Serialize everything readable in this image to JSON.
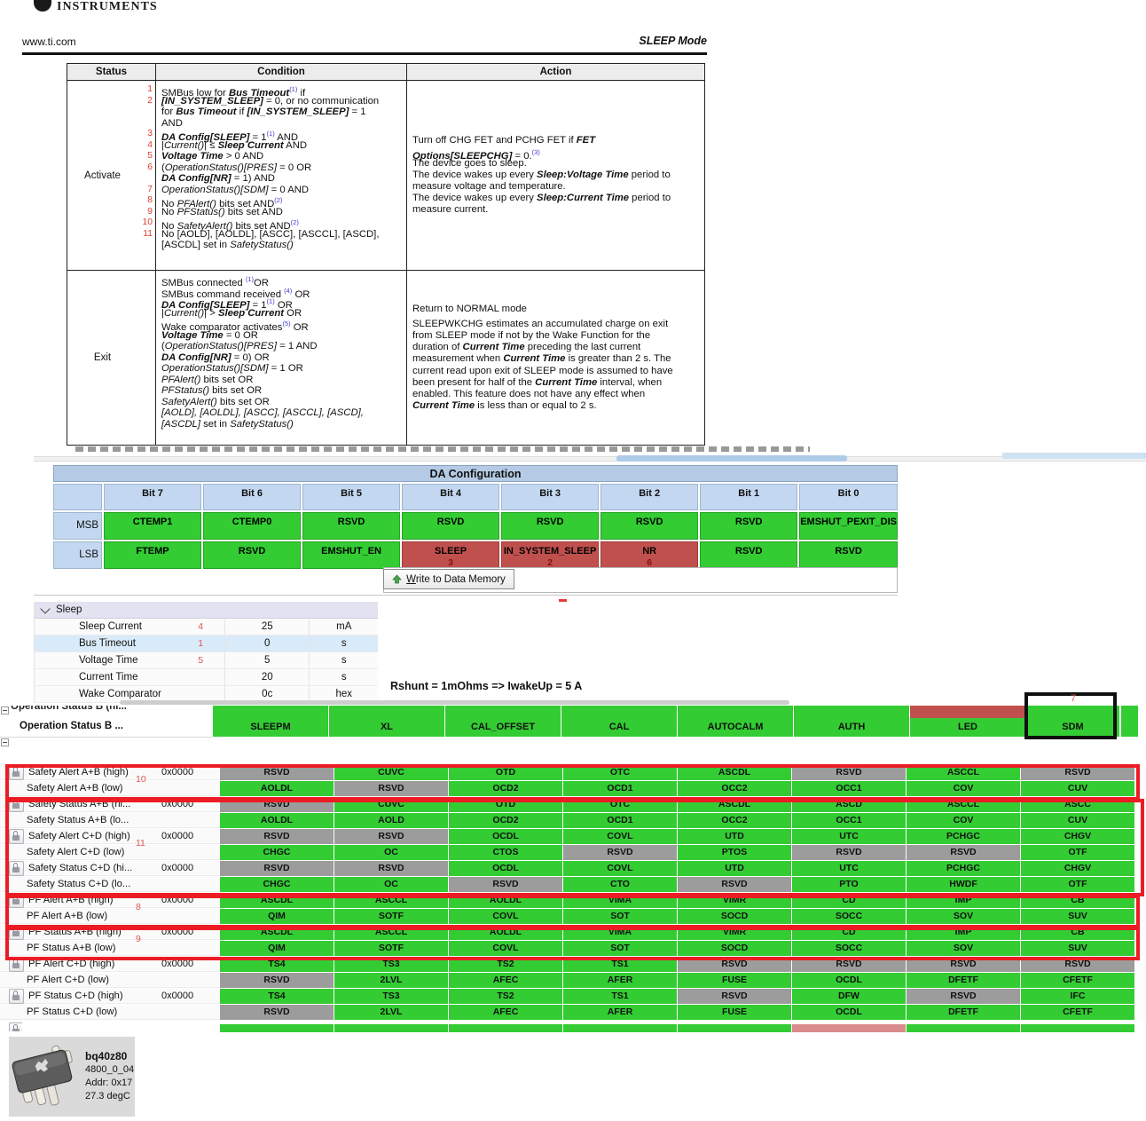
{
  "header": {
    "brand": "INSTRUMENTS",
    "site": "www.ti.com",
    "page_title": "SLEEP Mode"
  },
  "doc_table": {
    "columns": [
      "Status",
      "Condition",
      "Action"
    ],
    "rows": [
      {
        "status": "Activate",
        "conditions": [
          {
            "n": "1",
            "t": "SMBus low for **Bus Timeout**^(1) if"
          },
          {
            "n": "2",
            "t": "**[IN_SYSTEM_SLEEP]** = 0, or no communication"
          },
          {
            "n": "",
            "t": "for **Bus Timeout** if **[IN_SYSTEM_SLEEP]** = 1"
          },
          {
            "n": "",
            "t": "AND"
          },
          {
            "n": "3",
            "t": "**DA Config[SLEEP]** = 1^(1) AND"
          },
          {
            "n": "4",
            "t": "|*Current()*| ≤ **Sleep Current** AND"
          },
          {
            "n": "5",
            "t": "**Voltage Time** > 0 AND"
          },
          {
            "n": "6",
            "t": "(*OperationStatus()[PRES]* = 0 OR"
          },
          {
            "n": "",
            "t": "**DA Config[NR]** = 1) AND"
          },
          {
            "n": "7",
            "t": "*OperationStatus()[SDM]* = 0 AND"
          },
          {
            "n": "8",
            "t": "No *PFAlert()* bits set AND^(2)"
          },
          {
            "n": "9",
            "t": "No *PFStatus()* bits set AND"
          },
          {
            "n": "10",
            "t": "No *SafetyAlert()* bits set AND^(2)"
          },
          {
            "n": "11",
            "t": "No [AOLD], [AOLDL], [ASCC], [ASCCL], [ASCD],"
          },
          {
            "n": "",
            "t": "[ASCDL] set in *SafetyStatus()*"
          }
        ],
        "action": [
          "Turn off CHG FET and PCHG FET if **FET**",
          "**Options[SLEEPCHG]** = 0.^(3)",
          "The device goes to sleep.",
          "The device wakes up every **Sleep:Voltage Time** period to",
          "measure voltage and temperature.",
          "The device wakes up every **Sleep:Current Time** period to",
          "measure current."
        ]
      },
      {
        "status": "Exit",
        "conditions": [
          {
            "n": "",
            "t": "SMBus connected ^(1)OR"
          },
          {
            "n": "",
            "t": "SMBus command received ^(4) OR"
          },
          {
            "n": "",
            "t": "**DA Config[SLEEP]** = 1^(1) OR"
          },
          {
            "n": "",
            "t": "|*Current()*| > **Sleep Current** OR"
          },
          {
            "n": "",
            "t": "Wake comparator activates^(5) OR"
          },
          {
            "n": "",
            "t": "**Voltage Time** = 0 OR"
          },
          {
            "n": "",
            "t": "(*OperationStatus()[PRES]* = 1 AND"
          },
          {
            "n": "",
            "t": "**DA Config[NR]** = 0) OR"
          },
          {
            "n": "",
            "t": "*OperationStatus()[SDM]* = 1 OR"
          },
          {
            "n": "",
            "t": "*PFAlert()* bits set OR"
          },
          {
            "n": "",
            "t": "*PFStatus()* bits set OR"
          },
          {
            "n": "",
            "t": "*SafetyAlert()* bits set OR"
          },
          {
            "n": "",
            "t": "*[AOLD], [AOLDL], [ASCC], [ASCCL], [ASCD],*"
          },
          {
            "n": "",
            "t": "*[ASCDL]* set in *SafetyStatus()*"
          }
        ],
        "action": [
          "Return to NORMAL mode",
          "SLEEPWKCHG estimates an accumulated charge on exit",
          "from SLEEP mode if not by the Wake Function for the",
          "duration of **Current Time** preceding the last current",
          "measurement when **Current Time** is greater than 2 s. The",
          "current read upon exit of SLEEP mode is assumed to have",
          "been present for half of the **Current Time** interval, when",
          "enabled. This feature does not have any effect when",
          "**Current Time** is less than or equal to 2 s."
        ],
        "action_gap_after_first": true
      }
    ]
  },
  "da_config": {
    "title": "DA Configuration",
    "bit_headers": [
      "Bit 7",
      "Bit 6",
      "Bit 5",
      "Bit 4",
      "Bit 3",
      "Bit 2",
      "Bit 1",
      "Bit 0"
    ],
    "row_labels": [
      "MSB",
      "LSB"
    ],
    "msb": [
      {
        "t": "CTEMP1"
      },
      {
        "t": "CTEMP0"
      },
      {
        "t": "RSVD"
      },
      {
        "t": "RSVD"
      },
      {
        "t": "RSVD"
      },
      {
        "t": "RSVD"
      },
      {
        "t": "RSVD"
      },
      {
        "t": "EMSHUT_PEXIT_DIS"
      }
    ],
    "lsb": [
      {
        "t": "FTEMP"
      },
      {
        "t": "RSVD"
      },
      {
        "t": "EMSHUT_EN"
      },
      {
        "t": "SLEEP",
        "n": "3",
        "red": true
      },
      {
        "t": "IN_SYSTEM_SLEEP",
        "n": "2",
        "red": true
      },
      {
        "t": "NR",
        "n": "6",
        "red": true
      },
      {
        "t": "RSVD"
      },
      {
        "t": "RSVD"
      }
    ],
    "write_button": "Write to Data Memory"
  },
  "sleep_panel": {
    "group": "Sleep",
    "rows": [
      {
        "label": "Sleep Current",
        "note": "4",
        "value": "25",
        "unit": "mA"
      },
      {
        "label": "Bus Timeout",
        "note": "1",
        "value": "0",
        "unit": "s",
        "highlight": true
      },
      {
        "label": "Voltage Time",
        "note": "5",
        "value": "5",
        "unit": "s"
      },
      {
        "label": "Current Time",
        "note": "",
        "value": "20",
        "unit": "s"
      },
      {
        "label": "Wake Comparator",
        "note": "",
        "value": "0c",
        "unit": "hex"
      }
    ],
    "annotation": "Rshunt = 1mOhms => IwakeUp =  5 A"
  },
  "op_status": {
    "clipped_label": "Operation Status B (hi...",
    "label": "Operation Status B ...",
    "cells": [
      "SLEEPM",
      "XL",
      "CAL_OFFSET",
      "CAL",
      "AUTOCALM",
      "AUTH",
      "LED",
      "SDM"
    ],
    "clipped_cell_colors": [
      "g",
      "g",
      "g",
      "g",
      "g",
      "g",
      "r",
      "g"
    ],
    "highlight_note": "7"
  },
  "registers": {
    "rows": [
      {
        "label": "Safety Alert A+B (high)",
        "lock": true,
        "value": "0x0000",
        "note": "10",
        "cells": [
          [
            "RSVD",
            "x"
          ],
          [
            "CUVC"
          ],
          [
            "OTD"
          ],
          [
            "OTC"
          ],
          [
            "ASCDL"
          ],
          [
            "RSVD",
            "x"
          ],
          [
            "ASCCL"
          ],
          [
            "RSVD",
            "x"
          ]
        ]
      },
      {
        "label": "Safety Alert A+B (low)",
        "lock": false,
        "value": "",
        "note": "",
        "cells": [
          [
            "AOLDL"
          ],
          [
            "RSVD",
            "x"
          ],
          [
            "OCD2"
          ],
          [
            "OCD1"
          ],
          [
            "OCC2"
          ],
          [
            "OCC1"
          ],
          [
            "COV"
          ],
          [
            "CUV"
          ]
        ]
      },
      {
        "label": "Safety Status A+B (hi...",
        "lock": true,
        "value": "0x0000",
        "note": "",
        "cells": [
          [
            "RSVD",
            "x"
          ],
          [
            "CUVC"
          ],
          [
            "OTD"
          ],
          [
            "OTC"
          ],
          [
            "ASCDL"
          ],
          [
            "ASCD"
          ],
          [
            "ASCCL"
          ],
          [
            "ASCC"
          ]
        ]
      },
      {
        "label": "Safety Status A+B (lo...",
        "lock": false,
        "value": "",
        "note": "",
        "cells": [
          [
            "AOLDL"
          ],
          [
            "AOLD"
          ],
          [
            "OCD2"
          ],
          [
            "OCD1"
          ],
          [
            "OCC2"
          ],
          [
            "OCC1"
          ],
          [
            "COV"
          ],
          [
            "CUV"
          ]
        ]
      },
      {
        "label": "Safety Alert C+D (high)",
        "lock": true,
        "value": "0x0000",
        "note": "11",
        "cells": [
          [
            "RSVD",
            "x"
          ],
          [
            "RSVD",
            "x"
          ],
          [
            "OCDL"
          ],
          [
            "COVL"
          ],
          [
            "UTD"
          ],
          [
            "UTC"
          ],
          [
            "PCHGC"
          ],
          [
            "CHGV"
          ]
        ]
      },
      {
        "label": "Safety Alert C+D (low)",
        "lock": false,
        "value": "",
        "note": "",
        "cells": [
          [
            "CHGC"
          ],
          [
            "OC"
          ],
          [
            "CTOS"
          ],
          [
            "RSVD",
            "x"
          ],
          [
            "PTOS"
          ],
          [
            "RSVD",
            "x"
          ],
          [
            "RSVD",
            "x"
          ],
          [
            "OTF"
          ]
        ]
      },
      {
        "label": "Safety Status C+D (hi...",
        "lock": true,
        "value": "0x0000",
        "note": "",
        "cells": [
          [
            "RSVD",
            "x"
          ],
          [
            "RSVD",
            "x"
          ],
          [
            "OCDL"
          ],
          [
            "COVL"
          ],
          [
            "UTD"
          ],
          [
            "UTC"
          ],
          [
            "PCHGC"
          ],
          [
            "CHGV"
          ]
        ]
      },
      {
        "label": "Safety Status C+D (lo...",
        "lock": false,
        "value": "",
        "note": "",
        "cells": [
          [
            "CHGC"
          ],
          [
            "OC"
          ],
          [
            "RSVD",
            "x"
          ],
          [
            "CTO"
          ],
          [
            "RSVD",
            "x"
          ],
          [
            "PTO"
          ],
          [
            "HWDF"
          ],
          [
            "OTF"
          ]
        ]
      },
      {
        "label": "PF Alert A+B (high)",
        "lock": true,
        "value": "0x0000",
        "note": "8",
        "cells": [
          [
            "ASCDL"
          ],
          [
            "ASCCL"
          ],
          [
            "AOLDL"
          ],
          [
            "VIMA"
          ],
          [
            "VIMR"
          ],
          [
            "CD"
          ],
          [
            "IMP"
          ],
          [
            "CB"
          ]
        ]
      },
      {
        "label": "PF Alert A+B (low)",
        "lock": false,
        "value": "",
        "note": "",
        "cells": [
          [
            "QIM"
          ],
          [
            "SOTF"
          ],
          [
            "COVL"
          ],
          [
            "SOT"
          ],
          [
            "SOCD"
          ],
          [
            "SOCC"
          ],
          [
            "SOV"
          ],
          [
            "SUV"
          ]
        ]
      },
      {
        "label": "PF Status A+B (high)",
        "lock": true,
        "value": "0x0000",
        "note": "9",
        "cells": [
          [
            "ASCDL"
          ],
          [
            "ASCCL"
          ],
          [
            "AOLDL"
          ],
          [
            "VIMA"
          ],
          [
            "VIMR"
          ],
          [
            "CD"
          ],
          [
            "IMP"
          ],
          [
            "CB"
          ]
        ]
      },
      {
        "label": "PF Status A+B (low)",
        "lock": false,
        "value": "",
        "note": "",
        "cells": [
          [
            "QIM"
          ],
          [
            "SOTF"
          ],
          [
            "COVL"
          ],
          [
            "SOT"
          ],
          [
            "SOCD"
          ],
          [
            "SOCC"
          ],
          [
            "SOV"
          ],
          [
            "SUV"
          ]
        ]
      },
      {
        "label": "PF Alert C+D (high)",
        "lock": true,
        "value": "0x0000",
        "note": "",
        "cells": [
          [
            "TS4"
          ],
          [
            "TS3"
          ],
          [
            "TS2"
          ],
          [
            "TS1"
          ],
          [
            "RSVD",
            "x"
          ],
          [
            "RSVD",
            "x"
          ],
          [
            "RSVD",
            "x"
          ],
          [
            "RSVD",
            "x"
          ]
        ]
      },
      {
        "label": "PF Alert C+D (low)",
        "lock": false,
        "value": "",
        "note": "",
        "cells": [
          [
            "RSVD",
            "x"
          ],
          [
            "2LVL"
          ],
          [
            "AFEC"
          ],
          [
            "AFER"
          ],
          [
            "FUSE"
          ],
          [
            "OCDL"
          ],
          [
            "DFETF"
          ],
          [
            "CFETF"
          ]
        ]
      },
      {
        "label": "PF Status C+D (high)",
        "lock": true,
        "value": "0x0000",
        "note": "",
        "cells": [
          [
            "TS4"
          ],
          [
            "TS3"
          ],
          [
            "TS2"
          ],
          [
            "TS1"
          ],
          [
            "RSVD",
            "x"
          ],
          [
            "DFW"
          ],
          [
            "RSVD",
            "x"
          ],
          [
            "IFC"
          ]
        ]
      },
      {
        "label": "PF Status C+D (low)",
        "lock": false,
        "value": "",
        "note": "",
        "cells": [
          [
            "RSVD",
            "x"
          ],
          [
            "2LVL"
          ],
          [
            "AFEC"
          ],
          [
            "AFER"
          ],
          [
            "FUSE"
          ],
          [
            "OCDL"
          ],
          [
            "DFETF"
          ],
          [
            "CFETF"
          ]
        ]
      }
    ],
    "partial_row_colors": [
      "g",
      "g",
      "g",
      "g",
      "g",
      "r",
      "g",
      "g"
    ]
  },
  "device": {
    "name": "bq40z80",
    "version": "4800_0_04",
    "address": "Addr: 0x17",
    "temperature": "27.3 degC"
  }
}
